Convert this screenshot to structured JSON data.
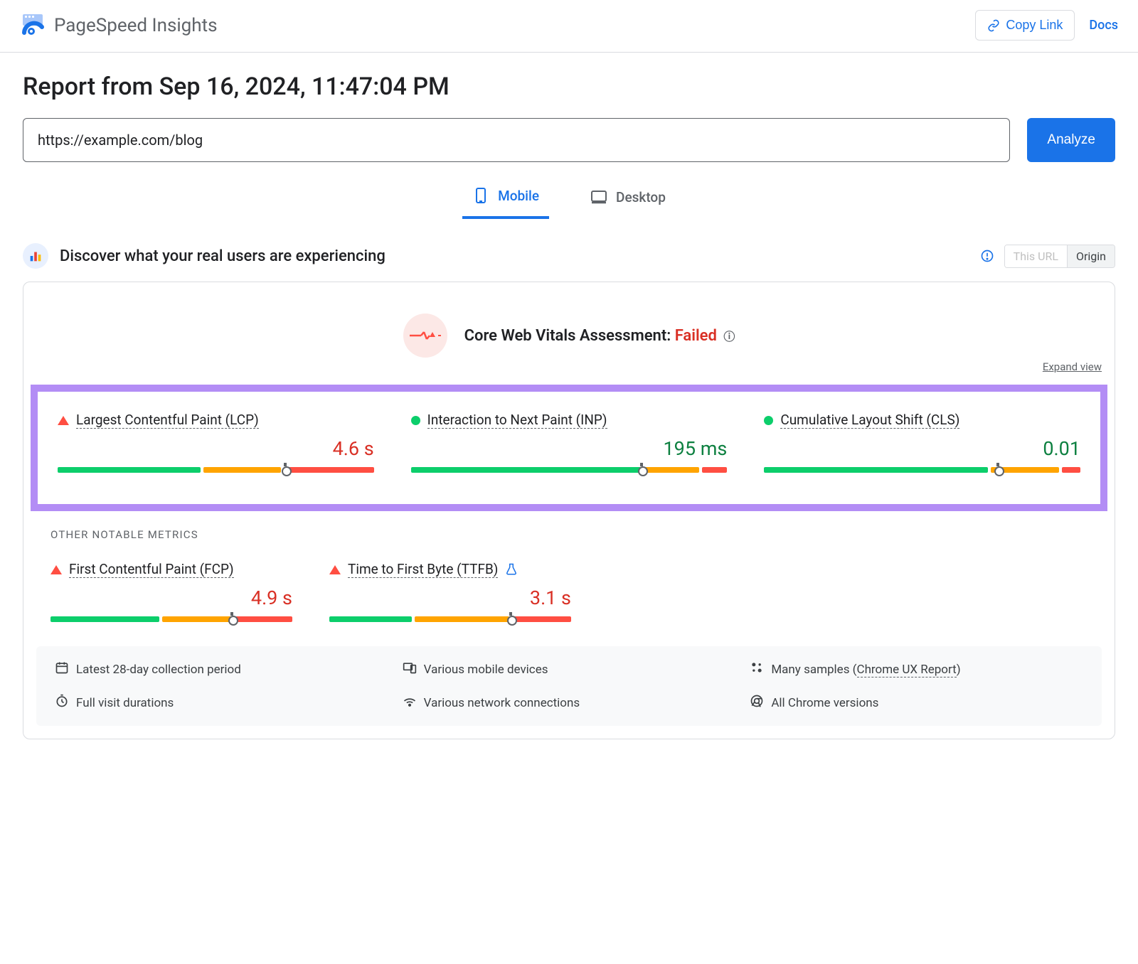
{
  "header": {
    "title": "PageSpeed Insights",
    "copy_link": "Copy Link",
    "docs": "Docs"
  },
  "report": {
    "heading": "Report from Sep 16, 2024, 11:47:04 PM",
    "url_value": "https://example.com/blog",
    "analyze_label": "Analyze"
  },
  "tabs": {
    "mobile": "Mobile",
    "desktop": "Desktop"
  },
  "discover": {
    "title": "Discover what your real users are experiencing",
    "seg_this_url": "This URL",
    "seg_origin": "Origin"
  },
  "cwv": {
    "label": "Core Web Vitals Assessment:",
    "status": "Failed",
    "expand": "Expand view"
  },
  "core_metrics": [
    {
      "name": "Largest Contentful Paint (LCP)",
      "value": "4.6 s",
      "status": "bad",
      "bar": {
        "g": 46,
        "y": 25,
        "r": 29,
        "marker": 72
      }
    },
    {
      "name": "Interaction to Next Paint (INP)",
      "value": "195 ms",
      "status": "good",
      "bar": {
        "g": 74,
        "y": 18,
        "r": 8,
        "marker": 73
      }
    },
    {
      "name": "Cumulative Layout Shift (CLS)",
      "value": "0.01",
      "status": "good",
      "bar": {
        "g": 72,
        "y": 22,
        "r": 6,
        "marker": 74
      }
    }
  ],
  "other": {
    "title": "OTHER NOTABLE METRICS",
    "metrics": [
      {
        "name": "First Contentful Paint (FCP)",
        "value": "4.9 s",
        "status": "bad",
        "bar": {
          "g": 46,
          "y": 30,
          "r": 24,
          "marker": 75
        },
        "flask": false
      },
      {
        "name": "Time to First Byte (TTFB)",
        "value": "3.1 s",
        "status": "bad",
        "bar": {
          "g": 35,
          "y": 40,
          "r": 25,
          "marker": 75
        },
        "flask": true
      }
    ]
  },
  "footer": [
    {
      "icon": "calendar",
      "text": "Latest 28-day collection period"
    },
    {
      "icon": "devices",
      "text": "Various mobile devices"
    },
    {
      "icon": "samples",
      "text_prefix": "Many samples (",
      "link": "Chrome UX Report",
      "text_suffix": ")"
    },
    {
      "icon": "timer",
      "text": "Full visit durations"
    },
    {
      "icon": "network",
      "text": "Various network connections"
    },
    {
      "icon": "chrome",
      "text": "All Chrome versions"
    }
  ]
}
